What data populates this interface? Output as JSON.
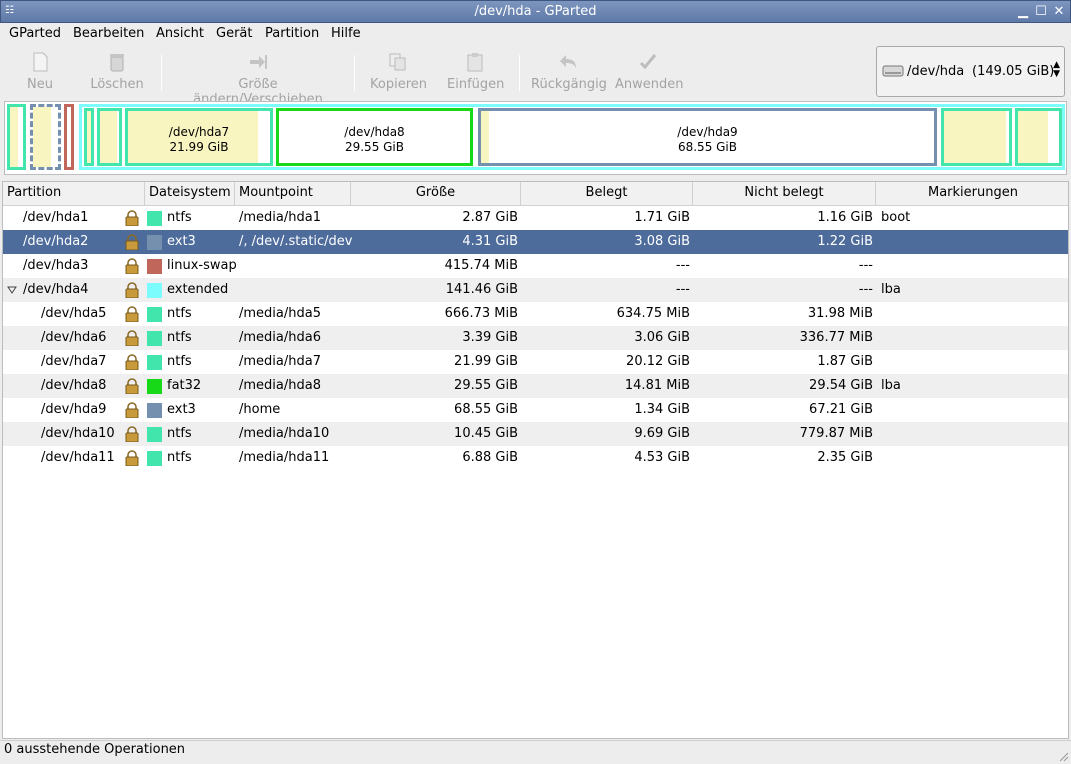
{
  "window": {
    "title": "/dev/hda - GParted"
  },
  "menubar": [
    {
      "label": "GParted"
    },
    {
      "label": "Bearbeiten"
    },
    {
      "label": "Ansicht"
    },
    {
      "label": "Gerät"
    },
    {
      "label": "Partition"
    },
    {
      "label": "Hilfe"
    }
  ],
  "toolbar": {
    "new": "Neu",
    "delete": "Löschen",
    "resize": "Größe ändern/Verschieben",
    "copy": "Kopieren",
    "paste": "Einfügen",
    "undo": "Rückgängig",
    "apply": "Anwenden"
  },
  "device_selector": {
    "device": "/dev/hda",
    "size": "(149.05 GiB)"
  },
  "diskmap": {
    "hda7": {
      "name": "/dev/hda7",
      "size": "21.99 GiB"
    },
    "hda8": {
      "name": "/dev/hda8",
      "size": "29.55 GiB"
    },
    "hda9": {
      "name": "/dev/hda9",
      "size": "68.55 GiB"
    }
  },
  "colors": {
    "ntfs": "#42e5ac",
    "ext3": "#7590ae",
    "linux-swap": "#c1665a",
    "extended": "#7dfcfe",
    "fat32": "#18d918",
    "selection": "#4d6c9c"
  },
  "table": {
    "headers": [
      "Partition",
      "Dateisystem",
      "Mountpoint",
      "Größe",
      "Belegt",
      "Nicht belegt",
      "Markierungen"
    ],
    "rows": [
      {
        "partition": "/dev/hda1",
        "fs": "ntfs",
        "mount": "/media/hda1",
        "size": "2.87 GiB",
        "used": "1.71 GiB",
        "unused": "1.16 GiB",
        "flags": "boot"
      },
      {
        "partition": "/dev/hda2",
        "fs": "ext3",
        "mount": "/, /dev/.static/dev",
        "size": "4.31 GiB",
        "used": "3.08 GiB",
        "unused": "1.22 GiB",
        "flags": ""
      },
      {
        "partition": "/dev/hda3",
        "fs": "linux-swap",
        "mount": "",
        "size": "415.74 MiB",
        "used": "---",
        "unused": "---",
        "flags": ""
      },
      {
        "partition": "/dev/hda4",
        "fs": "extended",
        "mount": "",
        "size": "141.46 GiB",
        "used": "---",
        "unused": "---",
        "flags": "lba"
      },
      {
        "partition": "/dev/hda5",
        "fs": "ntfs",
        "mount": "/media/hda5",
        "size": "666.73 MiB",
        "used": "634.75 MiB",
        "unused": "31.98 MiB",
        "flags": ""
      },
      {
        "partition": "/dev/hda6",
        "fs": "ntfs",
        "mount": "/media/hda6",
        "size": "3.39 GiB",
        "used": "3.06 GiB",
        "unused": "336.77 MiB",
        "flags": ""
      },
      {
        "partition": "/dev/hda7",
        "fs": "ntfs",
        "mount": "/media/hda7",
        "size": "21.99 GiB",
        "used": "20.12 GiB",
        "unused": "1.87 GiB",
        "flags": ""
      },
      {
        "partition": "/dev/hda8",
        "fs": "fat32",
        "mount": "/media/hda8",
        "size": "29.55 GiB",
        "used": "14.81 MiB",
        "unused": "29.54 GiB",
        "flags": "lba"
      },
      {
        "partition": "/dev/hda9",
        "fs": "ext3",
        "mount": "/home",
        "size": "68.55 GiB",
        "used": "1.34 GiB",
        "unused": "67.21 GiB",
        "flags": ""
      },
      {
        "partition": "/dev/hda10",
        "fs": "ntfs",
        "mount": "/media/hda10",
        "size": "10.45 GiB",
        "used": "9.69 GiB",
        "unused": "779.87 MiB",
        "flags": ""
      },
      {
        "partition": "/dev/hda11",
        "fs": "ntfs",
        "mount": "/media/hda11",
        "size": "6.88 GiB",
        "used": "4.53 GiB",
        "unused": "2.35 GiB",
        "flags": ""
      }
    ]
  },
  "status": {
    "text": "0 ausstehende Operationen"
  }
}
